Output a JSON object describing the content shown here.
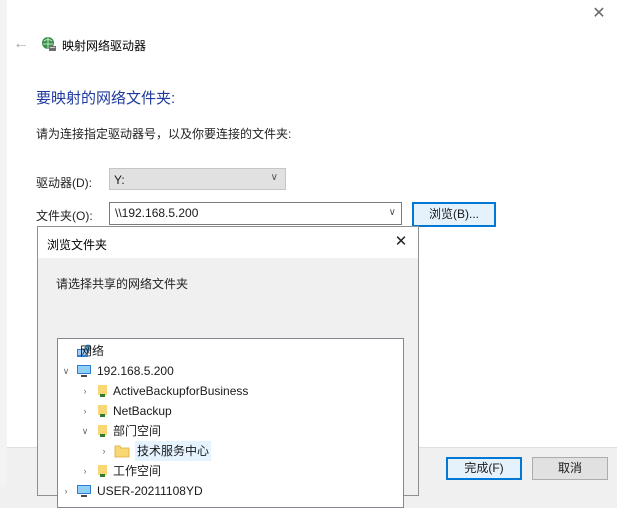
{
  "wizard": {
    "title": "映射网络驱动器",
    "heading": "要映射的网络文件夹:",
    "instruction": "请为连接指定驱动器号，以及你要连接的文件夹:",
    "drive_label": "驱动器(D):",
    "drive_value": "Y:",
    "folder_label": "文件夹(O):",
    "folder_value": "\\\\192.168.5.200",
    "browse_button": "浏览(B)...",
    "finish_button": "完成(F)",
    "cancel_button": "取消"
  },
  "browse_dialog": {
    "title": "浏览文件夹",
    "description": "请选择共享的网络文件夹",
    "tree": [
      {
        "label": "网络",
        "level": 0,
        "expander": "",
        "icon": "network-icon"
      },
      {
        "label": "192.168.5.200",
        "level": 1,
        "expander": "∨",
        "icon": "computer-icon"
      },
      {
        "label": "ActiveBackupforBusiness",
        "level": 2,
        "expander": "›",
        "icon": "shared-folder-icon"
      },
      {
        "label": "NetBackup",
        "level": 2,
        "expander": "›",
        "icon": "shared-folder-icon"
      },
      {
        "label": "部门空间",
        "level": 2,
        "expander": "∨",
        "icon": "shared-folder-icon"
      },
      {
        "label": "技术服务中心",
        "level": 3,
        "expander": "›",
        "icon": "folder-icon",
        "selected": true
      },
      {
        "label": "工作空间",
        "level": 2,
        "expander": "›",
        "icon": "shared-folder-icon"
      },
      {
        "label": "USER-20211108YD",
        "level": 1,
        "expander": "›",
        "icon": "computer-icon"
      }
    ]
  },
  "colors": {
    "heading": "#1e3a9e",
    "accent": "#0078d7",
    "selection": "#e5f3ff"
  }
}
